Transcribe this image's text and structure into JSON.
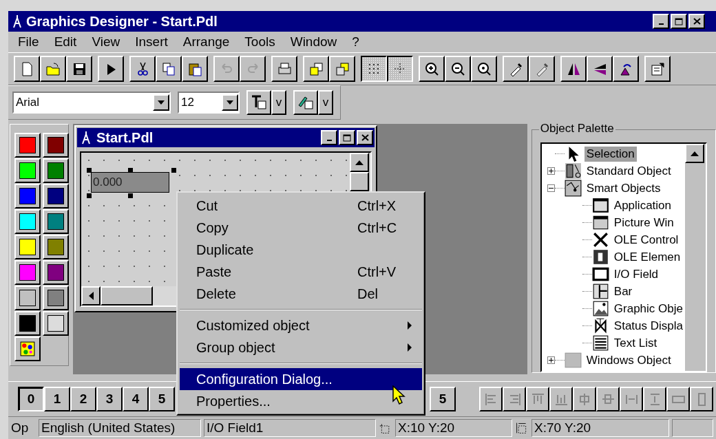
{
  "window": {
    "title": "Graphics Designer - Start.Pdl"
  },
  "menu": [
    "File",
    "Edit",
    "View",
    "Insert",
    "Arrange",
    "Tools",
    "Window",
    "?"
  ],
  "toolbar": [
    [
      {
        "kind": "new",
        "disabled": false,
        "pressed": false
      },
      {
        "kind": "open",
        "disabled": false,
        "pressed": false
      },
      {
        "kind": "save",
        "disabled": false,
        "pressed": false
      }
    ],
    [
      {
        "kind": "run",
        "disabled": false,
        "pressed": false
      }
    ],
    [
      {
        "kind": "cut",
        "disabled": false,
        "pressed": false
      },
      {
        "kind": "copy",
        "disabled": false,
        "pressed": false
      },
      {
        "kind": "paste",
        "disabled": false,
        "pressed": false
      }
    ],
    [
      {
        "kind": "undo",
        "disabled": true,
        "pressed": false
      },
      {
        "kind": "redo",
        "disabled": true,
        "pressed": false
      }
    ],
    [
      {
        "kind": "print",
        "disabled": false,
        "pressed": false
      }
    ],
    [
      {
        "kind": "front",
        "disabled": false,
        "pressed": false
      },
      {
        "kind": "back",
        "disabled": false,
        "pressed": false
      }
    ],
    [
      {
        "kind": "grid",
        "disabled": false,
        "pressed": true
      },
      {
        "kind": "snap",
        "disabled": false,
        "pressed": true
      }
    ],
    [
      {
        "kind": "zoomin",
        "disabled": false,
        "pressed": false
      },
      {
        "kind": "zoomout",
        "disabled": false,
        "pressed": false
      },
      {
        "kind": "zoomfit",
        "disabled": false,
        "pressed": false
      }
    ],
    [
      {
        "kind": "pipette",
        "disabled": false,
        "pressed": false
      },
      {
        "kind": "pipette",
        "disabled": true,
        "pressed": false
      }
    ],
    [
      {
        "kind": "mirrorh",
        "disabled": false,
        "pressed": false
      },
      {
        "kind": "mirrorv",
        "disabled": false,
        "pressed": false
      },
      {
        "kind": "rotate",
        "disabled": false,
        "pressed": false
      }
    ],
    [
      {
        "kind": "properties",
        "disabled": false,
        "pressed": false
      }
    ]
  ],
  "format_bar": {
    "font": "Arial",
    "size": "12",
    "text_color_button": "v",
    "line_color_button": "v"
  },
  "color_palette": [
    {
      "kind": "swatch",
      "color": "#ff0000"
    },
    {
      "kind": "swatch",
      "color": "#800000"
    },
    {
      "kind": "swatch",
      "color": "#00ff00"
    },
    {
      "kind": "swatch",
      "color": "#008000"
    },
    {
      "kind": "swatch",
      "color": "#0000ff"
    },
    {
      "kind": "swatch",
      "color": "#000080"
    },
    {
      "kind": "swatch",
      "color": "#00ffff"
    },
    {
      "kind": "swatch",
      "color": "#008080"
    },
    {
      "kind": "swatch",
      "color": "#ffff00"
    },
    {
      "kind": "swatch",
      "color": "#808000"
    },
    {
      "kind": "swatch",
      "color": "#ff00ff"
    },
    {
      "kind": "swatch",
      "color": "#800080"
    },
    {
      "kind": "swatch",
      "color": "#c0c0c0"
    },
    {
      "kind": "swatch",
      "color": "#808080"
    },
    {
      "kind": "swatch",
      "color": "#000000"
    },
    {
      "kind": "swatch",
      "color": "#dcdcdc"
    },
    {
      "kind": "custom"
    }
  ],
  "picture_window": {
    "title": "Start.Pdl",
    "io_field": {
      "value": "0.000",
      "selected": true
    }
  },
  "context_menu": [
    {
      "kind": "item",
      "label": "Cut",
      "shortcut": "Ctrl+X",
      "selected": false
    },
    {
      "kind": "item",
      "label": "Copy",
      "shortcut": "Ctrl+C",
      "selected": false
    },
    {
      "kind": "item",
      "label": "Duplicate",
      "selected": false
    },
    {
      "kind": "item",
      "label": "Paste",
      "shortcut": "Ctrl+V",
      "selected": false
    },
    {
      "kind": "item",
      "label": "Delete",
      "shortcut": "Del",
      "selected": false
    },
    {
      "kind": "separator"
    },
    {
      "kind": "submenu",
      "label": "Customized object",
      "selected": false
    },
    {
      "kind": "submenu",
      "label": "Group object",
      "selected": false
    },
    {
      "kind": "separator"
    },
    {
      "kind": "item",
      "label": "Configuration Dialog...",
      "selected": true
    },
    {
      "kind": "item",
      "label": "Properties...",
      "selected": false
    }
  ],
  "object_palette": {
    "title": "Object Palette",
    "tree": [
      {
        "kind": "selection",
        "label": "Selection",
        "selected": true
      },
      {
        "kind": "standard",
        "label": "Standard Object",
        "selected": false,
        "expanded": false
      },
      {
        "kind": "smart",
        "label": "Smart Objects",
        "selected": false,
        "expanded": true,
        "children": [
          {
            "kind": "appwindow",
            "label": "Application",
            "selected": false
          },
          {
            "kind": "picwindow",
            "label": "Picture Win",
            "selected": false
          },
          {
            "kind": "olecontrol",
            "label": "OLE Control",
            "selected": false
          },
          {
            "kind": "oleelement",
            "label": "OLE Elemen",
            "selected": false
          },
          {
            "kind": "iofield",
            "label": "I/O Field",
            "selected": false
          },
          {
            "kind": "bar",
            "label": "Bar",
            "selected": false
          },
          {
            "kind": "graphic",
            "label": "Graphic Obje",
            "selected": false
          },
          {
            "kind": "status",
            "label": "Status Displa",
            "selected": false
          },
          {
            "kind": "textlist",
            "label": "Text List",
            "selected": false
          }
        ]
      },
      {
        "kind": "windows",
        "label": "Windows Object",
        "selected": false,
        "expanded": false
      }
    ]
  },
  "layers": {
    "buttons": [
      {
        "label": "0",
        "selected": true
      },
      {
        "label": "1",
        "selected": false
      },
      {
        "label": "2",
        "selected": false
      },
      {
        "label": "3",
        "selected": false
      },
      {
        "label": "4",
        "selected": false
      },
      {
        "label": "5",
        "selected": false
      }
    ],
    "tail": "5"
  },
  "status_bar": {
    "hint": "Op",
    "language": "English (United States)",
    "object": "I/O Field1",
    "position": "X:10 Y:20",
    "size": "X:70 Y:20"
  }
}
